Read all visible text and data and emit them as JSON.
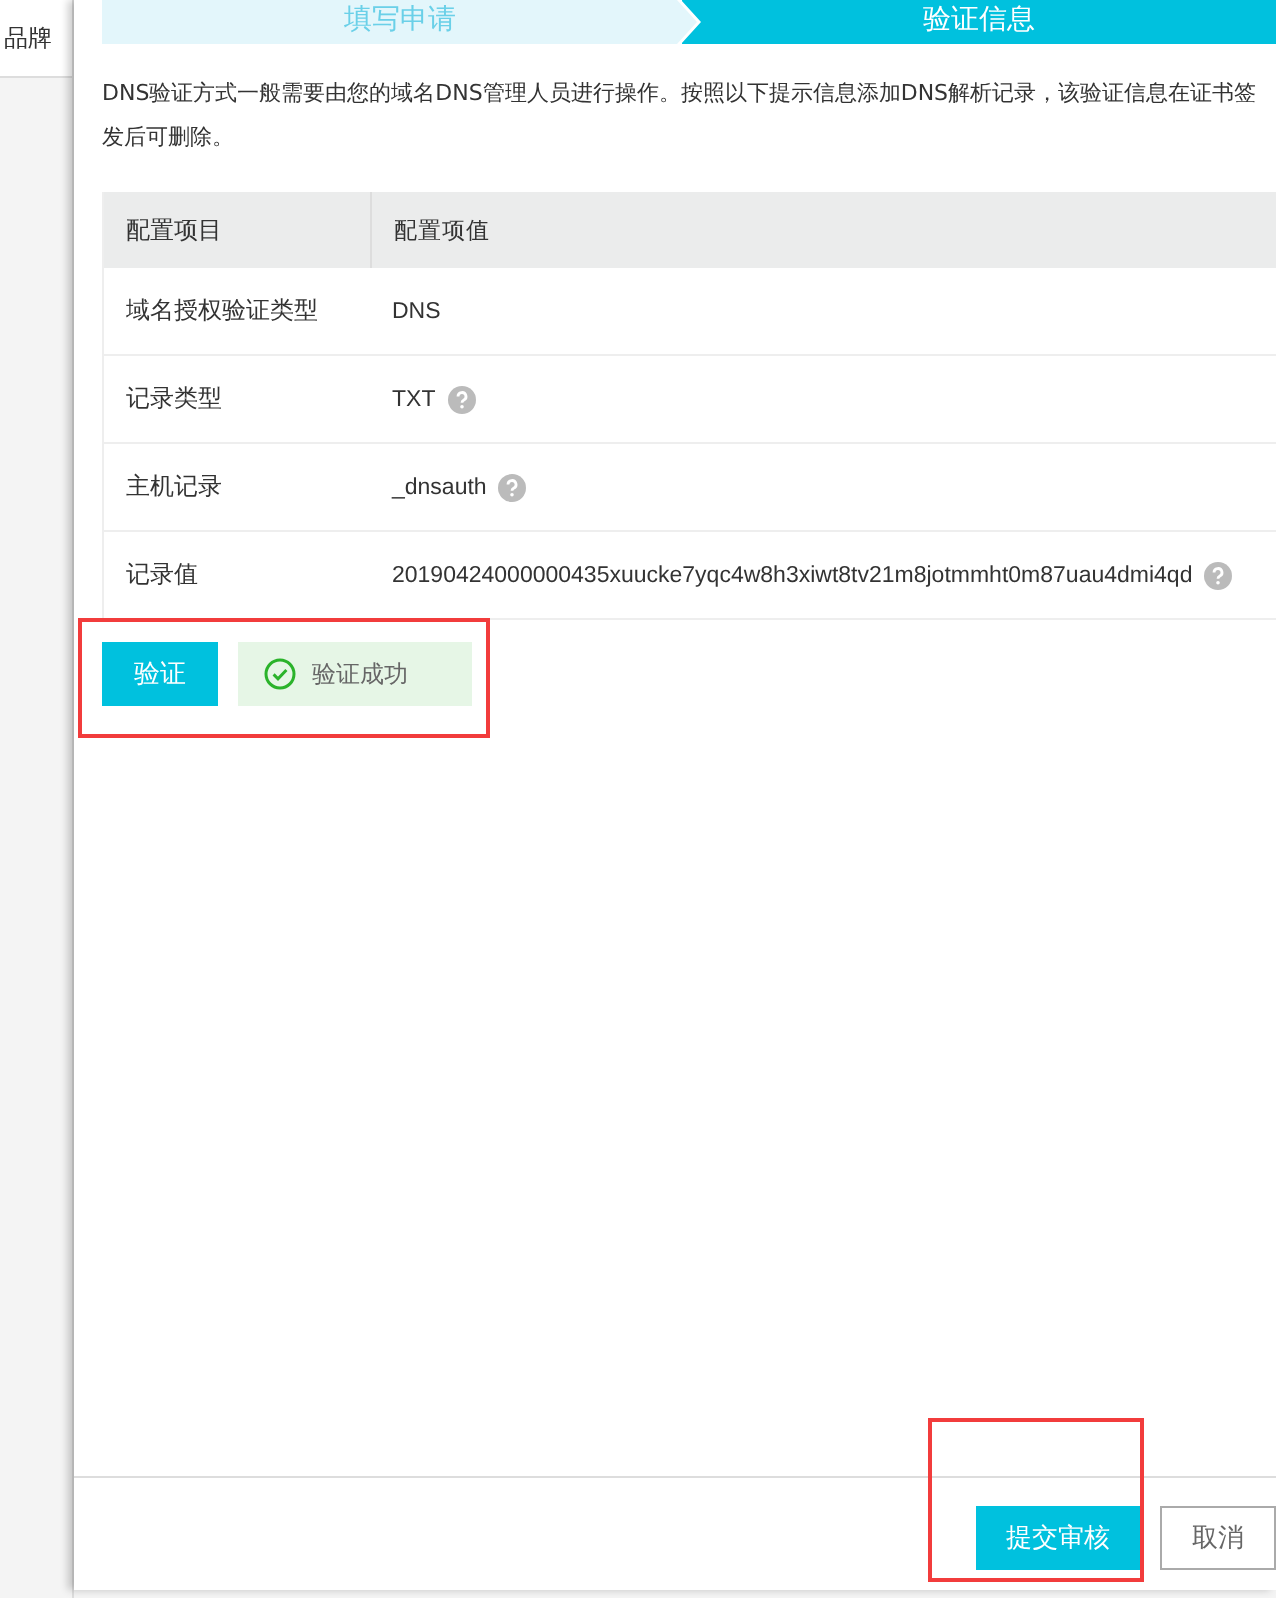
{
  "sidebar": {
    "items": [
      {
        "label": "品牌"
      }
    ]
  },
  "steps": [
    {
      "label": "填写申请",
      "selected": false
    },
    {
      "label": "验证信息",
      "selected": true
    }
  ],
  "description": "DNS验证方式一般需要由您的域名DNS管理人员进行操作。按照以下提示信息添加DNS解析记录，该验证信息在证书签发后可删除。",
  "table": {
    "columns": [
      "配置项目",
      "配置项值"
    ],
    "rows": [
      {
        "item": "域名授权验证类型",
        "value": "DNS",
        "help": false
      },
      {
        "item": "记录类型",
        "value": "TXT",
        "help": true
      },
      {
        "item": "主机记录",
        "value": "_dnsauth",
        "help": true
      },
      {
        "item": "记录值",
        "value": "20190424000000435xuucke7yqc4w8h3xiwt8tv21m8jotmmht0m87uau4dmi4qd",
        "help": true
      }
    ]
  },
  "verify_button": "验证",
  "verify_status": {
    "text": "验证成功",
    "success": true
  },
  "footer_buttons": [
    {
      "label": "提交审核",
      "kind": "primary"
    },
    {
      "label": "取消",
      "kind": "secondary"
    }
  ]
}
